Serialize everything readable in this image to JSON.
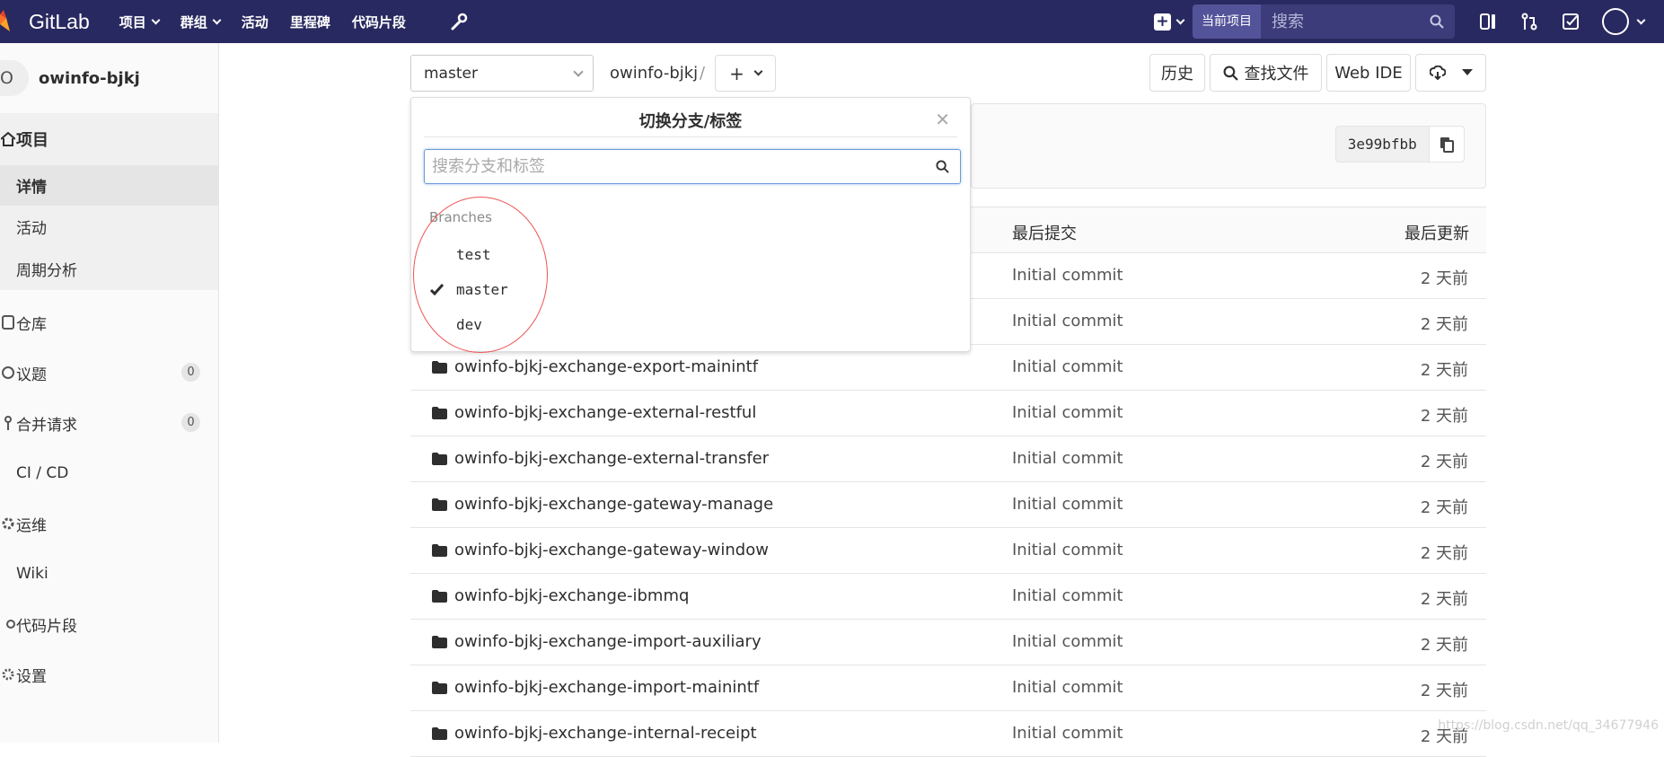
{
  "navbar": {
    "logo_text": "GitLab",
    "items": [
      "项目",
      "群组",
      "活动",
      "里程碑",
      "代码片段"
    ],
    "search_scope": "当前项目",
    "search_placeholder": "搜索",
    "brand_color": "#292961"
  },
  "sidebar": {
    "project_initial": "O",
    "project_name": "owinfo-bjkj",
    "section_label": "项目",
    "sub_items": [
      "详情",
      "活动",
      "周期分析"
    ],
    "items": [
      {
        "label": "仓库",
        "icon": "book-icon"
      },
      {
        "label": "议题",
        "icon": "issues-icon",
        "count": "0"
      },
      {
        "label": "合并请求",
        "icon": "merge-request-icon",
        "count": "0"
      },
      {
        "label": "CI / CD",
        "icon": "rocket-icon"
      },
      {
        "label": "运维",
        "icon": "cloud-gear-icon"
      },
      {
        "label": "Wiki",
        "icon": "book-open-icon"
      },
      {
        "label": "代码片段",
        "icon": "snippet-icon"
      },
      {
        "label": "设置",
        "icon": "gear-icon"
      }
    ]
  },
  "toolbar": {
    "branch": "master",
    "breadcrumb": "owinfo-bjkj",
    "separator": "/",
    "history": "历史",
    "find_file": "查找文件",
    "web_ide": "Web IDE"
  },
  "commit": {
    "sha": "3e99bfbb"
  },
  "table": {
    "col_commit": "最后提交",
    "col_update": "最后更新",
    "rows": [
      {
        "name": "",
        "commit": "Initial commit",
        "time": "2 天前"
      },
      {
        "name": "",
        "commit": "Initial commit",
        "time": "2 天前"
      },
      {
        "name": "owinfo-bjkj-exchange-export-mainintf",
        "commit": "Initial commit",
        "time": "2 天前"
      },
      {
        "name": "owinfo-bjkj-exchange-external-restful",
        "commit": "Initial commit",
        "time": "2 天前"
      },
      {
        "name": "owinfo-bjkj-exchange-external-transfer",
        "commit": "Initial commit",
        "time": "2 天前"
      },
      {
        "name": "owinfo-bjkj-exchange-gateway-manage",
        "commit": "Initial commit",
        "time": "2 天前"
      },
      {
        "name": "owinfo-bjkj-exchange-gateway-window",
        "commit": "Initial commit",
        "time": "2 天前"
      },
      {
        "name": "owinfo-bjkj-exchange-ibmmq",
        "commit": "Initial commit",
        "time": "2 天前"
      },
      {
        "name": "owinfo-bjkj-exchange-import-auxiliary",
        "commit": "Initial commit",
        "time": "2 天前"
      },
      {
        "name": "owinfo-bjkj-exchange-import-mainintf",
        "commit": "Initial commit",
        "time": "2 天前"
      },
      {
        "name": "owinfo-bjkj-exchange-internal-receipt",
        "commit": "Initial commit",
        "time": "2 天前"
      }
    ]
  },
  "dropdown": {
    "title": "切换分支/标签",
    "search_placeholder": "搜索分支和标签",
    "section": "Branches",
    "branches": [
      "test",
      "master",
      "dev"
    ],
    "selected": "master"
  },
  "watermark": "https://blog.csdn.net/qq_34677946"
}
